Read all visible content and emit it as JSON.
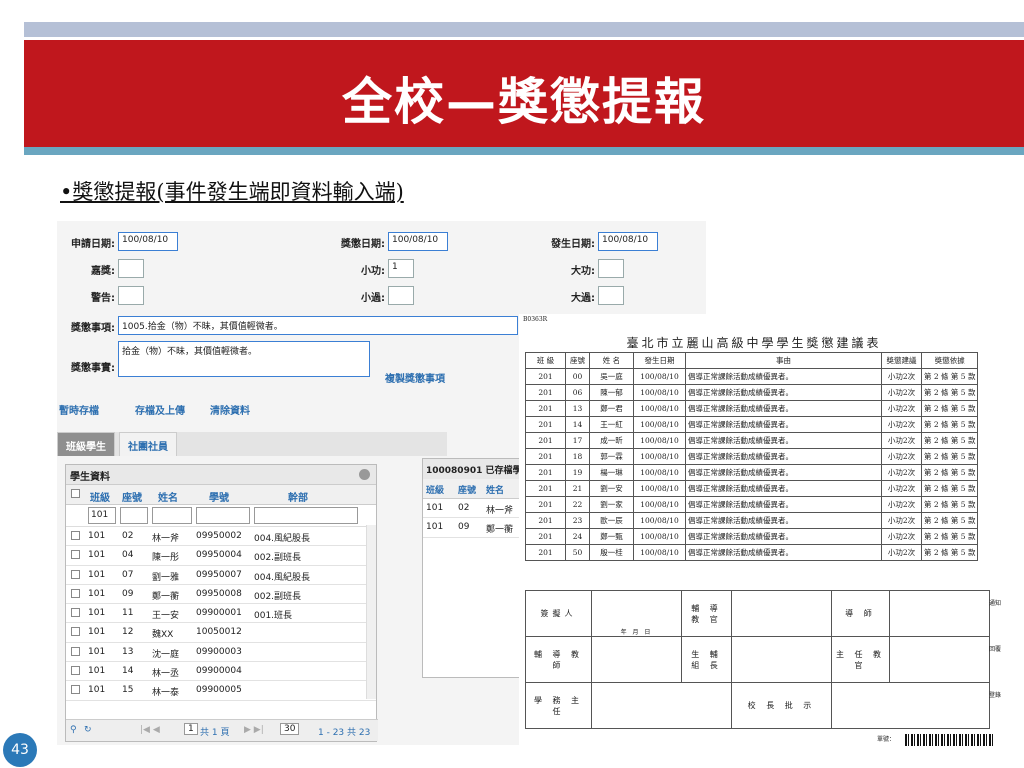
{
  "slide": {
    "title": "全校—獎懲提報",
    "bullet": "•獎懲提報(事件發生端即資料輸入端)",
    "page_number": "43"
  },
  "form": {
    "apply_date_label": "申請日期:",
    "apply_date": "100/08/10",
    "award_date_label": "獎懲日期:",
    "award_date": "100/08/10",
    "occur_date_label": "發生日期:",
    "occur_date": "100/08/10",
    "commend_label": "嘉獎:",
    "minor_merit_label": "小功:",
    "minor_merit": "1",
    "major_merit_label": "大功:",
    "warning_label": "警告:",
    "minor_demerit_label": "小過:",
    "major_demerit_label": "大過:",
    "item_label": "獎懲事項:",
    "item_value": "1005.拾金（物）不昧，其價值輕微者。",
    "reason_label": "獎懲事實:",
    "reason_value": "拾金（物）不昧，其價值輕微者。",
    "copy_button": "複製獎懲事項",
    "temp_save": "暫時存檔",
    "save_upload": "存檔及上傳",
    "clear": "清除資料",
    "tabs": [
      "班級學生",
      "社團社員"
    ]
  },
  "student_grid": {
    "caption": "學生資料",
    "headers": [
      "班級",
      "座號",
      "姓名",
      "學號",
      "幹部"
    ],
    "filter_class": "101",
    "rows": [
      [
        "101",
        "02",
        "林一斧",
        "09950002",
        "004.風紀股長"
      ],
      [
        "101",
        "04",
        "陳一彤",
        "09950004",
        "002.副班長"
      ],
      [
        "101",
        "07",
        "劉一雅",
        "09950007",
        "004.風紀股長"
      ],
      [
        "101",
        "09",
        "鄭一蘅",
        "09950008",
        "002.副班長"
      ],
      [
        "101",
        "11",
        "王一安",
        "09900001",
        "001.班長"
      ],
      [
        "101",
        "12",
        "魏XX",
        "10050012",
        ""
      ],
      [
        "101",
        "13",
        "沈一庭",
        "09900003",
        ""
      ],
      [
        "101",
        "14",
        "林一丞",
        "09900004",
        ""
      ],
      [
        "101",
        "15",
        "林一泰",
        "09900005",
        ""
      ]
    ],
    "pager_page": "1",
    "pager_total": "共 1 頁",
    "pager_size": "30",
    "pager_range": "1 - 23  共 23"
  },
  "saved_grid": {
    "caption": "100080901 已存檔學",
    "headers": [
      "班級",
      "座號",
      "姓名"
    ],
    "rows": [
      [
        "101",
        "02",
        "林一斧"
      ],
      [
        "101",
        "09",
        "鄭一蘅"
      ]
    ]
  },
  "report": {
    "code": "B0363R",
    "title": "臺北市立麗山高級中學學生獎懲建議表",
    "headers": [
      "班 級",
      "座號",
      "姓 名",
      "發生日期",
      "事由",
      "獎懲建議",
      "獎懲依據"
    ],
    "reason_text": "倡導正常課餘活動成績優異者。",
    "suggestion": "小功2次",
    "basis": "第 2 條 第 5 款",
    "rows": [
      [
        "201",
        "00",
        "吳一庭",
        "100/08/10"
      ],
      [
        "201",
        "06",
        "陳一郁",
        "100/08/10"
      ],
      [
        "201",
        "13",
        "鄭一君",
        "100/08/10"
      ],
      [
        "201",
        "14",
        "王一紅",
        "100/08/10"
      ],
      [
        "201",
        "17",
        "成一昕",
        "100/08/10"
      ],
      [
        "201",
        "18",
        "郭一霖",
        "100/08/10"
      ],
      [
        "201",
        "19",
        "楊一琳",
        "100/08/10"
      ],
      [
        "201",
        "21",
        "劉一安",
        "100/08/10"
      ],
      [
        "201",
        "22",
        "劉一家",
        "100/08/10"
      ],
      [
        "201",
        "23",
        "歐一辰",
        "100/08/10"
      ],
      [
        "201",
        "24",
        "鄭一甄",
        "100/08/10"
      ],
      [
        "201",
        "50",
        "殷一桂",
        "100/08/10"
      ]
    ],
    "sig": {
      "proposer": "簽擬人",
      "date_hint": "年   月   日",
      "counselor": "輔 導 教 官",
      "mentor": "導 師",
      "guidance_teacher": "輔 導 教 師",
      "life_head": "生 輔 組 長",
      "chief_officer": "主 任 教 官",
      "academic_director": "學 務 主 任",
      "principal": "校 長 批 示",
      "side_notice": "通知",
      "side_record": "回覆",
      "side_register": "登錄",
      "serial_label": "單號："
    }
  }
}
